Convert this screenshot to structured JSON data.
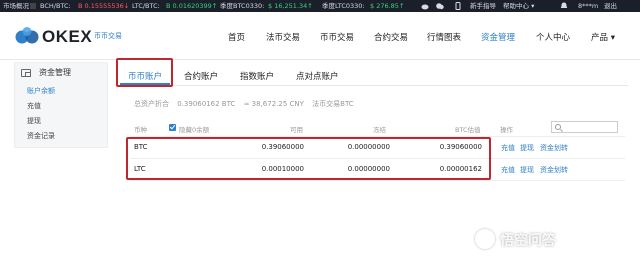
{
  "ticker": {
    "market_label": "市场概况",
    "pairs": [
      {
        "name": "BCH/BTC:",
        "value": "B 0.15555536↓",
        "trend": "down"
      },
      {
        "name": "LTC/BTC:",
        "value": "B 0.01620399↑",
        "trend": "up"
      },
      {
        "name": "季度BTC0330:",
        "value": "$ 16,251.34↑",
        "trend": "up"
      },
      {
        "name": "季度LTC0330:",
        "value": "$ 276.85↑",
        "trend": "up"
      }
    ],
    "right_links": [
      "新手指导",
      "帮助中心 ▾",
      "8***m",
      "退出"
    ],
    "colors": {
      "bg": "#1b1f29",
      "down": "#ff5c5c",
      "up": "#3ad082"
    }
  },
  "nav": {
    "logo_text": "OKEX",
    "logo_sub": "币币交易",
    "items": [
      "首页",
      "法币交易",
      "币币交易",
      "合约交易",
      "行情图表",
      "资金管理",
      "个人中心",
      "产品 ▾"
    ],
    "active_item": "资金管理",
    "accent": "#2f80c8"
  },
  "sidebar": {
    "title": "资金管理",
    "items": [
      "账户余额",
      "充值",
      "提现",
      "资金记录"
    ],
    "selected": "账户余额"
  },
  "tabs": [
    "币币账户",
    "合约账户",
    "指数账户",
    "点对点账户"
  ],
  "active_tab": "币币账户",
  "summary": {
    "total_label": "总资产折合",
    "btc_value": "0.39060162 BTC",
    "cny_value": "≈ 38,672.25 CNY",
    "btc_label": "法币交易BTC"
  },
  "table": {
    "headers": {
      "coin": "币种",
      "hide_zero": "隐藏0余额",
      "available": "可用",
      "frozen": "冻结",
      "btc_value": "BTC估值",
      "action": "操作"
    },
    "rows": [
      {
        "coin": "BTC",
        "available": "0.39060000",
        "frozen": "0.00000000",
        "btc_value": "0.39060000"
      },
      {
        "coin": "LTC",
        "available": "0.00010000",
        "frozen": "0.00000000",
        "btc_value": "0.00000162"
      }
    ],
    "actions": [
      "充值",
      "提现",
      "资金划转"
    ]
  },
  "watermark": "悟空问答",
  "highlight_color": "#c0262e"
}
